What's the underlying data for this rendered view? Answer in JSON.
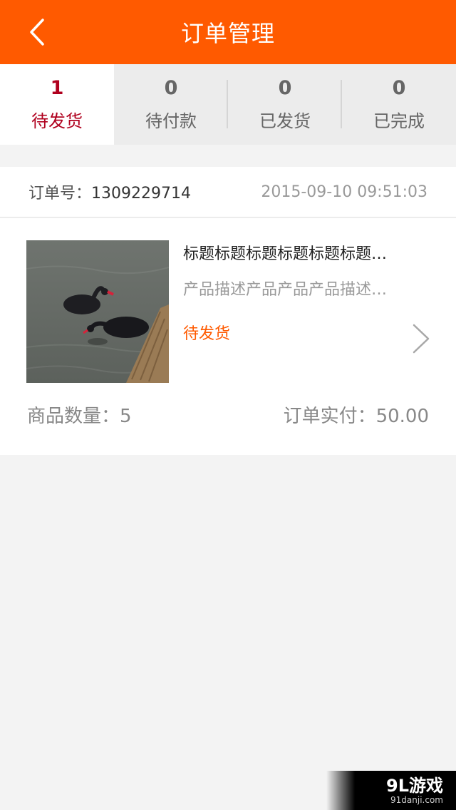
{
  "header": {
    "title": "订单管理",
    "back_icon": "chevron-left-icon"
  },
  "tabs": [
    {
      "count": "1",
      "label": "待发货",
      "active": true
    },
    {
      "count": "0",
      "label": "待付款",
      "active": false
    },
    {
      "count": "0",
      "label": "已发货",
      "active": false
    },
    {
      "count": "0",
      "label": "已完成",
      "active": false
    }
  ],
  "order": {
    "number_label": "订单号：",
    "number": "1309229714",
    "time": "2015-09-10 09:51:03",
    "item": {
      "title": "标题标题标题标题标题标题…",
      "description": "产品描述产品产品产品描述…",
      "status": "待发货",
      "image_icon": "black-swan-photo"
    },
    "quantity_text": "商品数量：5",
    "paid_text": "订单实付：50.00"
  },
  "watermark": {
    "brand": "9L游戏",
    "site": "91danji.com"
  },
  "colors": {
    "accent": "#ff5a00",
    "active_tab": "#b0001e",
    "background": "#f3f3f3"
  }
}
